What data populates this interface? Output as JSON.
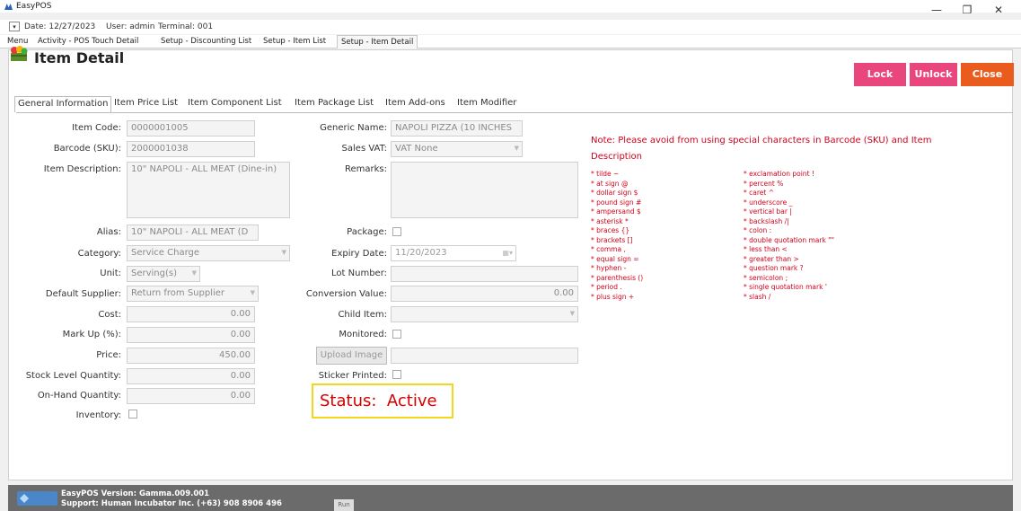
{
  "window": {
    "title": "EasyPOS",
    "minimize": "—",
    "maximize": "❐",
    "close": "✕"
  },
  "info": {
    "date": "Date: 12/27/2023",
    "user": "User: admin",
    "terminal": "Terminal: 001"
  },
  "menu_tabs": [
    "Menu",
    "Activity - POS Touch Detail",
    "Setup - Discounting List",
    "Setup - Item List",
    "Setup - Item Detail"
  ],
  "header": {
    "title": "Item Detail",
    "lock": "Lock",
    "unlock": "Unlock",
    "close": "Close"
  },
  "colors": {
    "lock": "#e8467c",
    "unlock": "#e8467c",
    "close": "#ea5b1e",
    "note": "#d0021b",
    "status": "#d60000",
    "status_border": "#f5d61e"
  },
  "sub_tabs": [
    "General Information",
    "Item Price List",
    "Item Component List",
    "Item Package List",
    "Item Add-ons",
    "Item Modifier"
  ],
  "left": {
    "item_code_label": "Item Code:",
    "item_code": "0000001005",
    "barcode_label": "Barcode (SKU):",
    "barcode": "2000001038",
    "desc_label": "Item Description:",
    "desc": "10\" NAPOLI - ALL MEAT (Dine-in)",
    "alias_label": "Alias:",
    "alias": "10\" NAPOLI - ALL MEAT (D",
    "category_label": "Category:",
    "category": "Service Charge",
    "unit_label": "Unit:",
    "unit": "Serving(s)",
    "supplier_label": "Default Supplier:",
    "supplier": "Return from Supplier",
    "cost_label": "Cost:",
    "cost": "0.00",
    "markup_label": "Mark Up (%):",
    "markup": "0.00",
    "price_label": "Price:",
    "price": "450.00",
    "stock_label": "Stock Level Quantity:",
    "stock": "0.00",
    "onhand_label": "On-Hand Quantity:",
    "onhand": "0.00",
    "inventory_label": "Inventory:"
  },
  "mid": {
    "generic_label": "Generic Name:",
    "generic": "NAPOLI PIZZA (10 INCHES",
    "vat_label": "Sales VAT:",
    "vat": "VAT None",
    "remarks_label": "Remarks:",
    "package_label": "Package:",
    "expiry_label": "Expiry Date:",
    "expiry": "11/20/2023",
    "lot_label": "Lot Number:",
    "conv_label": "Conversion Value:",
    "conv": "0.00",
    "child_label": "Child Item:",
    "monitored_label": "Monitored:",
    "upload_label": "Upload Image",
    "sticker_label": "Sticker Printed:",
    "status_label": "Status:",
    "status_value": "Active"
  },
  "note": {
    "text": "Note: Please avoid from using special characters in Barcode (SKU) and Item Description",
    "col1": [
      "* tilde ~",
      "* at sign @",
      "* dollar sign $",
      "* pound sign #",
      "* ampersand $",
      "* asterisk *",
      "* braces {}",
      "* brackets []",
      "* comma ,",
      "* equal sign =",
      "* hyphen -",
      "* parenthesis ()",
      "* period .",
      "* plus sign +"
    ],
    "col2": [
      "* exclamation point !",
      "* percent %",
      "* caret ^",
      "* underscore _",
      "* vertical bar |",
      "* backslash /|",
      "* colon :",
      "* double quotation mark \"\"",
      "* less than <",
      "* greater than >",
      "* question mark ?",
      "* semicolon ;",
      "* single quotation mark '",
      "* slash /"
    ]
  },
  "footer": {
    "version": "EasyPOS Version: Gamma.009.001",
    "support": "Support: Human Incubator Inc. (+63) 908 8906 496",
    "run": "Run"
  }
}
